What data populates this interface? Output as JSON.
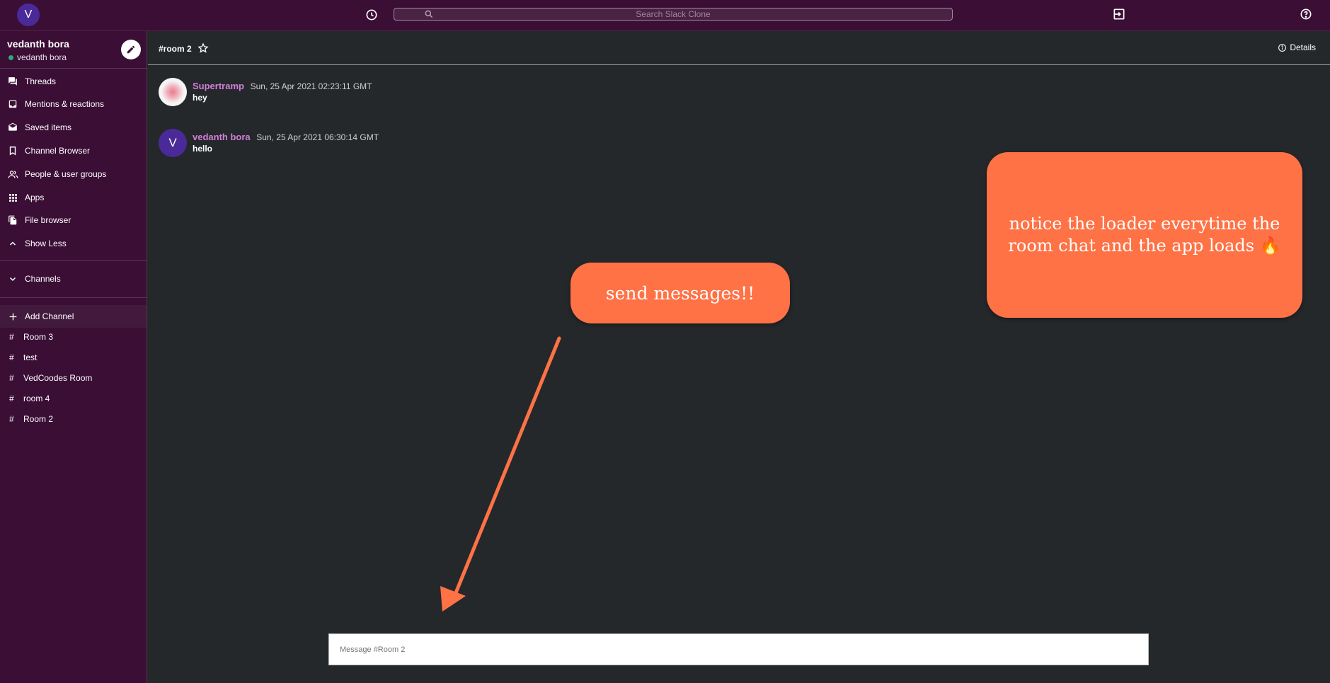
{
  "topbar": {
    "avatar_initial": "V",
    "search_placeholder": "Search Slack Clone"
  },
  "sidebar": {
    "workspace_name": "vedanth bora",
    "user_name": "vedanth bora",
    "status_color": "#2bac76",
    "items": [
      {
        "label": "Threads",
        "icon": "threads-icon"
      },
      {
        "label": "Mentions & reactions",
        "icon": "inbox-icon"
      },
      {
        "label": "Saved items",
        "icon": "drafts-icon"
      },
      {
        "label": "Channel Browser",
        "icon": "bookmark-icon"
      },
      {
        "label": "People & user groups",
        "icon": "people-icon"
      },
      {
        "label": "Apps",
        "icon": "apps-grid-icon"
      },
      {
        "label": "File browser",
        "icon": "file-copy-icon"
      },
      {
        "label": "Show Less",
        "icon": "chevron-up-icon"
      }
    ],
    "channels_label": "Channels",
    "add_channel_label": "Add Channel",
    "channels": [
      "Room 3",
      "test",
      "VedCoodes Room",
      "room 4",
      "Room 2"
    ]
  },
  "chat": {
    "room_title": "#room 2",
    "details_label": "Details",
    "messages": [
      {
        "user": "Supertramp",
        "time": "Sun, 25 Apr 2021 02:23:11 GMT",
        "text": "hey"
      },
      {
        "user": "vedanth bora",
        "time": "Sun, 25 Apr 2021 06:30:14 GMT",
        "text": "hello",
        "avatar_initial": "V"
      }
    ],
    "composer_placeholder": "Message #Room 2"
  },
  "annotations": {
    "send_callout": "send messages!!",
    "loader_callout": "notice the loader everytime the room chat and the app loads 🔥",
    "callout_color": "#fe7245"
  }
}
